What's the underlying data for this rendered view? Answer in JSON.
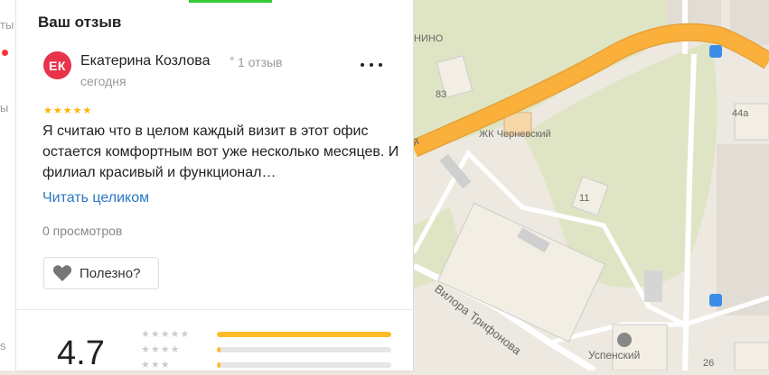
{
  "left_strip": {
    "text_top": "ты",
    "text_mid": "ы",
    "text_bottom": "s"
  },
  "review_section": {
    "title": "Ваш отзыв"
  },
  "review": {
    "avatar_initials": "ЕК",
    "avatar_color": "#e8334b",
    "author": "Екатерина Козлова",
    "separator": "•",
    "reviews_count": "1 отзыв",
    "date": "сегодня",
    "stars": "★★★★★",
    "rating": 5,
    "text": "Я считаю что в целом каждый визит в этот офис остается комфортным вот уже несколько месяцев. И филиал красивый и функционал…",
    "read_more": "Читать целиком",
    "views": "0 просмотров",
    "useful_button": "Полезно?"
  },
  "rating_summary": {
    "value": "4.7",
    "rows": [
      {
        "stars": "★★★★★",
        "fraction": 1.0
      },
      {
        "stars": "★★★★",
        "fraction": 0.02
      },
      {
        "stars": "★★★",
        "fraction": 0.02
      }
    ]
  },
  "map": {
    "labels": {
      "area_nino": "НИНО",
      "house_83": "83",
      "house_44a": "44а",
      "complex": "ЖК Черневский",
      "house_11": "11",
      "street_fragment": "я",
      "street_trifonova": "Вилора Трифонова",
      "uspensky": "Успенский",
      "house_26": "26"
    }
  },
  "colors": {
    "accent_link": "#2b78c3",
    "star": "#ffb400",
    "road": "#fbb03b",
    "map_bg": "#ede9e0",
    "park": "#dfe5c4"
  }
}
